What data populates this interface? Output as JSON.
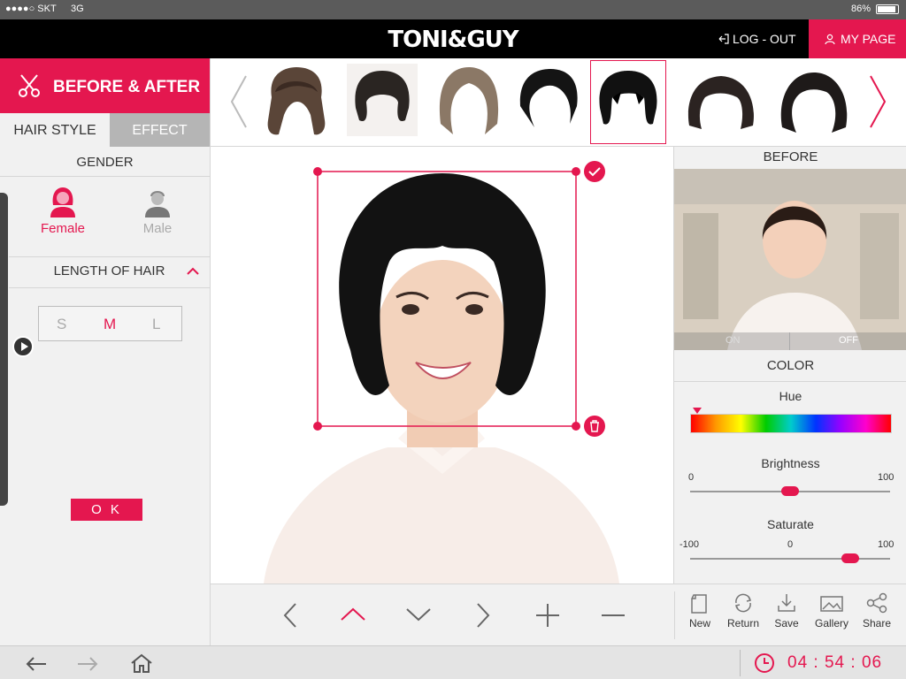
{
  "status_bar": {
    "carrier": "●●●●○ SKT",
    "network": "3G",
    "battery": "86%"
  },
  "header": {
    "brand": "TONI&GUY",
    "logout_label": "LOG - OUT",
    "mypage_label": "MY PAGE"
  },
  "sidebar": {
    "title": "BEFORE & AFTER",
    "tabs": [
      {
        "label": "HAIR STYLE"
      },
      {
        "label": "EFFECT"
      }
    ],
    "gender_label": "GENDER",
    "genders": [
      {
        "label": "Female"
      },
      {
        "label": "Male"
      }
    ],
    "length_label": "LENGTH  OF  HAIR",
    "lengths": [
      "S",
      "M",
      "L"
    ],
    "selected_length": "M",
    "ok_label": "O K"
  },
  "right_panel": {
    "before_label": "BEFORE",
    "on_label": "ON",
    "off_label": "OFF",
    "color_label": "COLOR",
    "hue_label": "Hue",
    "hue_value": 0.03,
    "brightness_label": "Brightness",
    "brightness_min": "0",
    "brightness_max": "100",
    "brightness_value": 50,
    "saturate_label": "Saturate",
    "saturate_min": "-100",
    "saturate_mid": "0",
    "saturate_max": "100",
    "saturate_value": 60
  },
  "toolbar": {
    "new_label": "New",
    "return_label": "Return",
    "save_label": "Save",
    "gallery_label": "Gallery",
    "share_label": "Share"
  },
  "timer": {
    "display": "04 : 54 : 06"
  },
  "colors": {
    "accent": "#e4174f",
    "header_bg": "#000000"
  }
}
